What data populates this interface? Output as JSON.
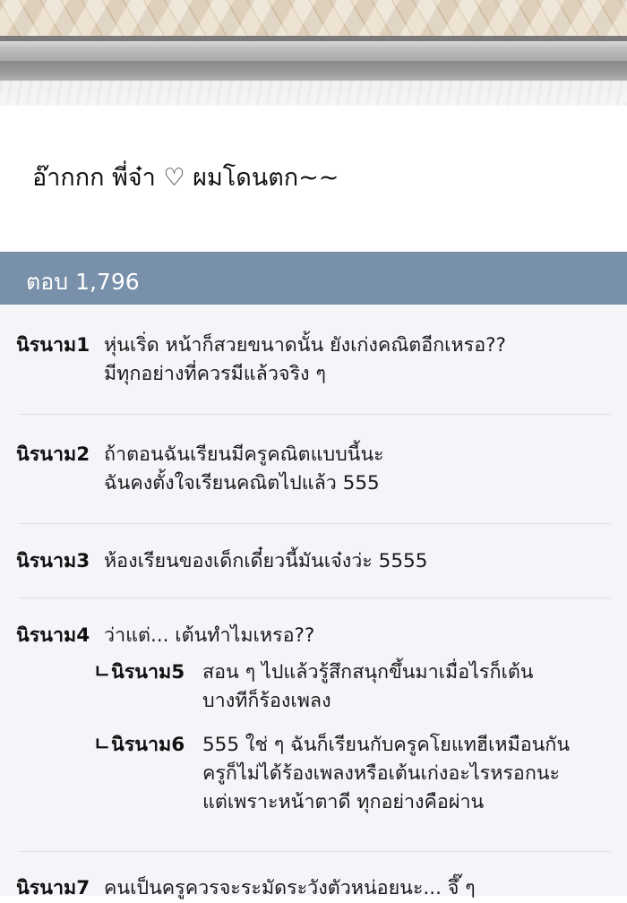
{
  "speech": "อ๊ากกก พี่จ๋า ♡ ผมโดนตก~~",
  "episode": "ตอบ 1,796",
  "comments": [
    {
      "nick": "นิรนาม1",
      "lines": [
        "หุ่นเริ่ด หน้าก็สวยขนาดนั้น ยังเก่งคณิตอีกเหรอ??",
        "มีทุกอย่างที่ควรมีแล้วจริง ๆ"
      ]
    },
    {
      "nick": "นิรนาม2",
      "lines": [
        "ถ้าตอนฉันเรียนมีครูคณิตแบบนี้นะ",
        "ฉันคงตั้งใจเรียนคณิตไปแล้ว 555"
      ]
    },
    {
      "nick": "นิรนาม3",
      "lines": [
        "ห้องเรียนของเด็กเดี๋ยวนี้มันเจ๋งว่ะ 5555"
      ]
    },
    {
      "nick": "นิรนาม4",
      "lines": [
        "ว่าแต่... เต้นทำไมเหรอ??"
      ],
      "replies": [
        {
          "mark": "ㄴ",
          "nick": "นิรนาม5",
          "lines": [
            "สอน ๆ ไปแล้วรู้สึกสนุกขึ้นมาเมื่อไรก็เต้น",
            "บางทีก็ร้องเพลง"
          ]
        },
        {
          "mark": "ㄴ",
          "nick": "นิรนาม6",
          "lines": [
            "555 ใช่ ๆ ฉันก็เรียนกับครูคโยแทฮีเหมือนกัน",
            "ครูก็ไม่ได้ร้องเพลงหรือเต้นเก่งอะไรหรอกนะ",
            "แต่เพราะหน้าตาดี ทุกอย่างคือผ่าน"
          ]
        }
      ]
    },
    {
      "nick": "นิรนาม7",
      "lines": [
        "คนเป็นครูควรจะระมัดระวังตัวหน่อยนะ... จึ๊ ๆ"
      ]
    }
  ]
}
